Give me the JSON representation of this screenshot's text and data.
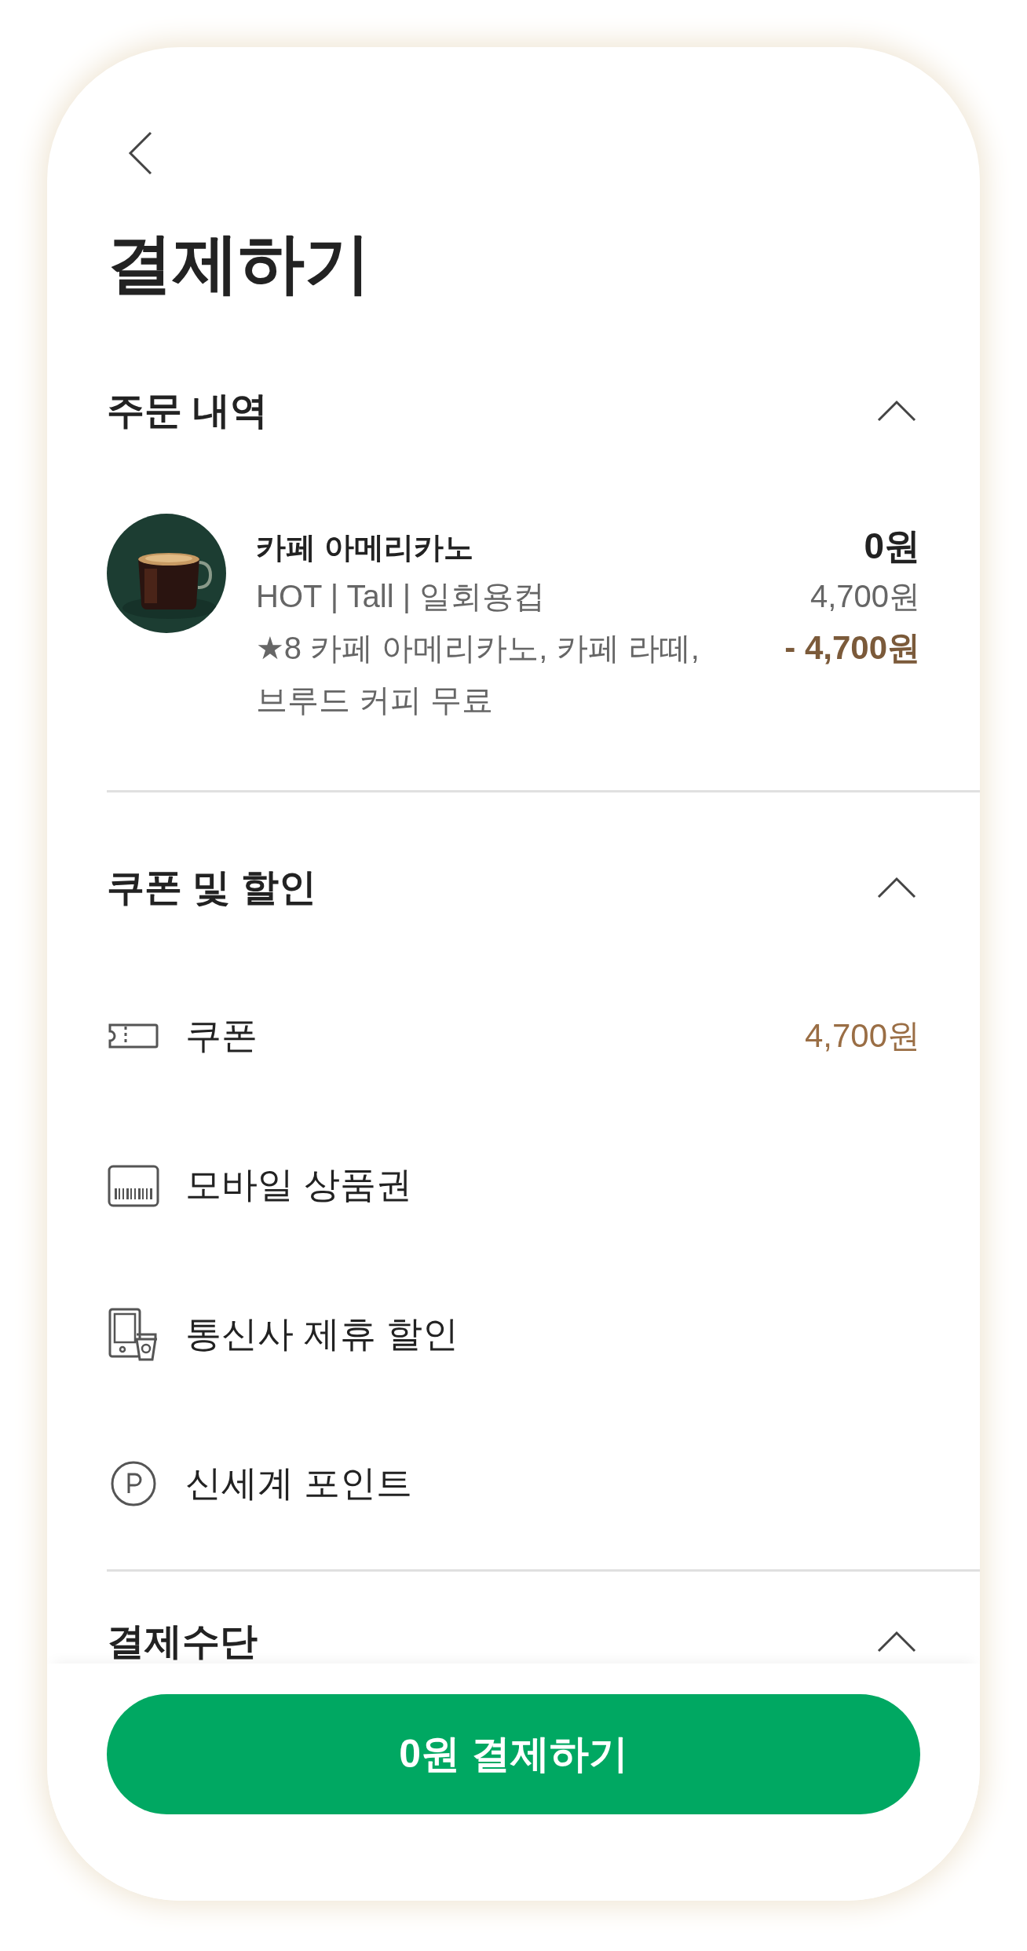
{
  "title": "결제하기",
  "order_section": {
    "title": "주문 내역",
    "expanded": true,
    "items": [
      {
        "name": "카페 아메리카노",
        "options": "HOT | Tall | 일회용컵",
        "benefit": "★8 카페 아메리카노, 카페 라떼, 브루드 커피 무료",
        "price": "0원",
        "original_price": "4,700원",
        "discount": "- 4,700원"
      }
    ]
  },
  "discount_section": {
    "title": "쿠폰 및 할인",
    "expanded": true,
    "items": [
      {
        "kind": "coupon",
        "label": "쿠폰",
        "value": "4,700원"
      },
      {
        "kind": "gift_card",
        "label": "모바일 상품권"
      },
      {
        "kind": "telecom",
        "label": "통신사 제휴 할인"
      },
      {
        "kind": "points",
        "label": "신세계 포인트"
      }
    ]
  },
  "payment_section": {
    "title": "결제수단",
    "expanded": true
  },
  "pay_button": "0원 결제하기"
}
